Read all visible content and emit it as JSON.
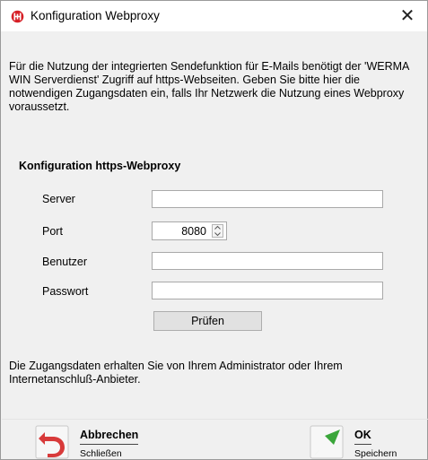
{
  "window": {
    "title": "Konfiguration Webproxy",
    "close_label": "✕",
    "icon": "werma-logo-icon"
  },
  "intro_text": "Für die Nutzung der integrierten Sendefunktion für E-Mails benötigt der 'WERMA WIN Serverdienst' Zugriff auf https-Webseiten. Geben Sie bitte hier die notwendigen Zugangsdaten ein, falls Ihr Netzwerk die Nutzung eines Webproxy voraussetzt.",
  "section_title": "Konfiguration https-Webproxy",
  "form": {
    "server": {
      "label": "Server",
      "value": ""
    },
    "port": {
      "label": "Port",
      "value": "8080"
    },
    "user": {
      "label": "Benutzer",
      "value": ""
    },
    "password": {
      "label": "Passwort",
      "value": ""
    },
    "check_button": "Prüfen"
  },
  "note_text": "Die Zugangsdaten erhalten Sie von Ihrem Administrator oder Ihrem Internetanschluß-Anbieter.",
  "footer": {
    "cancel": {
      "title": "Abbrechen",
      "subtitle": "Schließen",
      "icon": "undo-arrow-icon"
    },
    "ok": {
      "title": "OK",
      "subtitle": "Speichern",
      "icon": "check-arrow-icon"
    }
  },
  "colors": {
    "dialog_bg": "#f0f0f0",
    "title_bg": "#ffffff",
    "brand_red": "#d61f26",
    "ok_green": "#3aa63a",
    "cancel_red": "#d83a3a"
  }
}
